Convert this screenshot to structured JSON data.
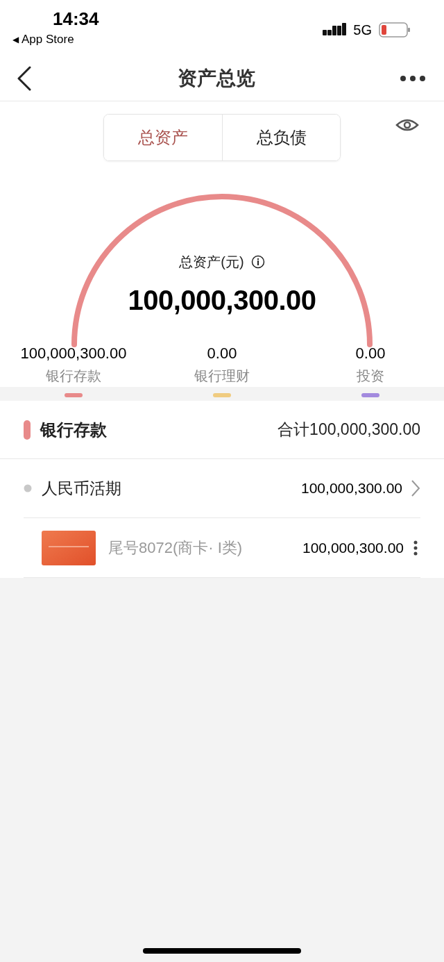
{
  "status_bar": {
    "time": "14:34",
    "back_arrow": "◀",
    "back_label": "App Store",
    "network": "5G"
  },
  "nav": {
    "title": "资产总览"
  },
  "tabs": [
    {
      "label": "总资产",
      "selected": true
    },
    {
      "label": "总负债",
      "selected": false
    }
  ],
  "gauge": {
    "label": "总资产(元)",
    "amount": "100,000,300.00"
  },
  "categories": [
    {
      "amount": "100,000,300.00",
      "label": "银行存款",
      "color": "#e88a8a"
    },
    {
      "amount": "0.00",
      "label": "银行理财",
      "color": "#f0cc80"
    },
    {
      "amount": "0.00",
      "label": "投资",
      "color": "#a38ade"
    }
  ],
  "section": {
    "title": "银行存款",
    "total": "合计100,000,300.00",
    "color": "#e88a8a"
  },
  "accounts": [
    {
      "kind": "group",
      "name": "人民币活期",
      "amount": "100,000,300.00"
    },
    {
      "kind": "card",
      "name": "尾号8072(商卡· I类)",
      "amount": "100,000,300.00"
    }
  ]
}
